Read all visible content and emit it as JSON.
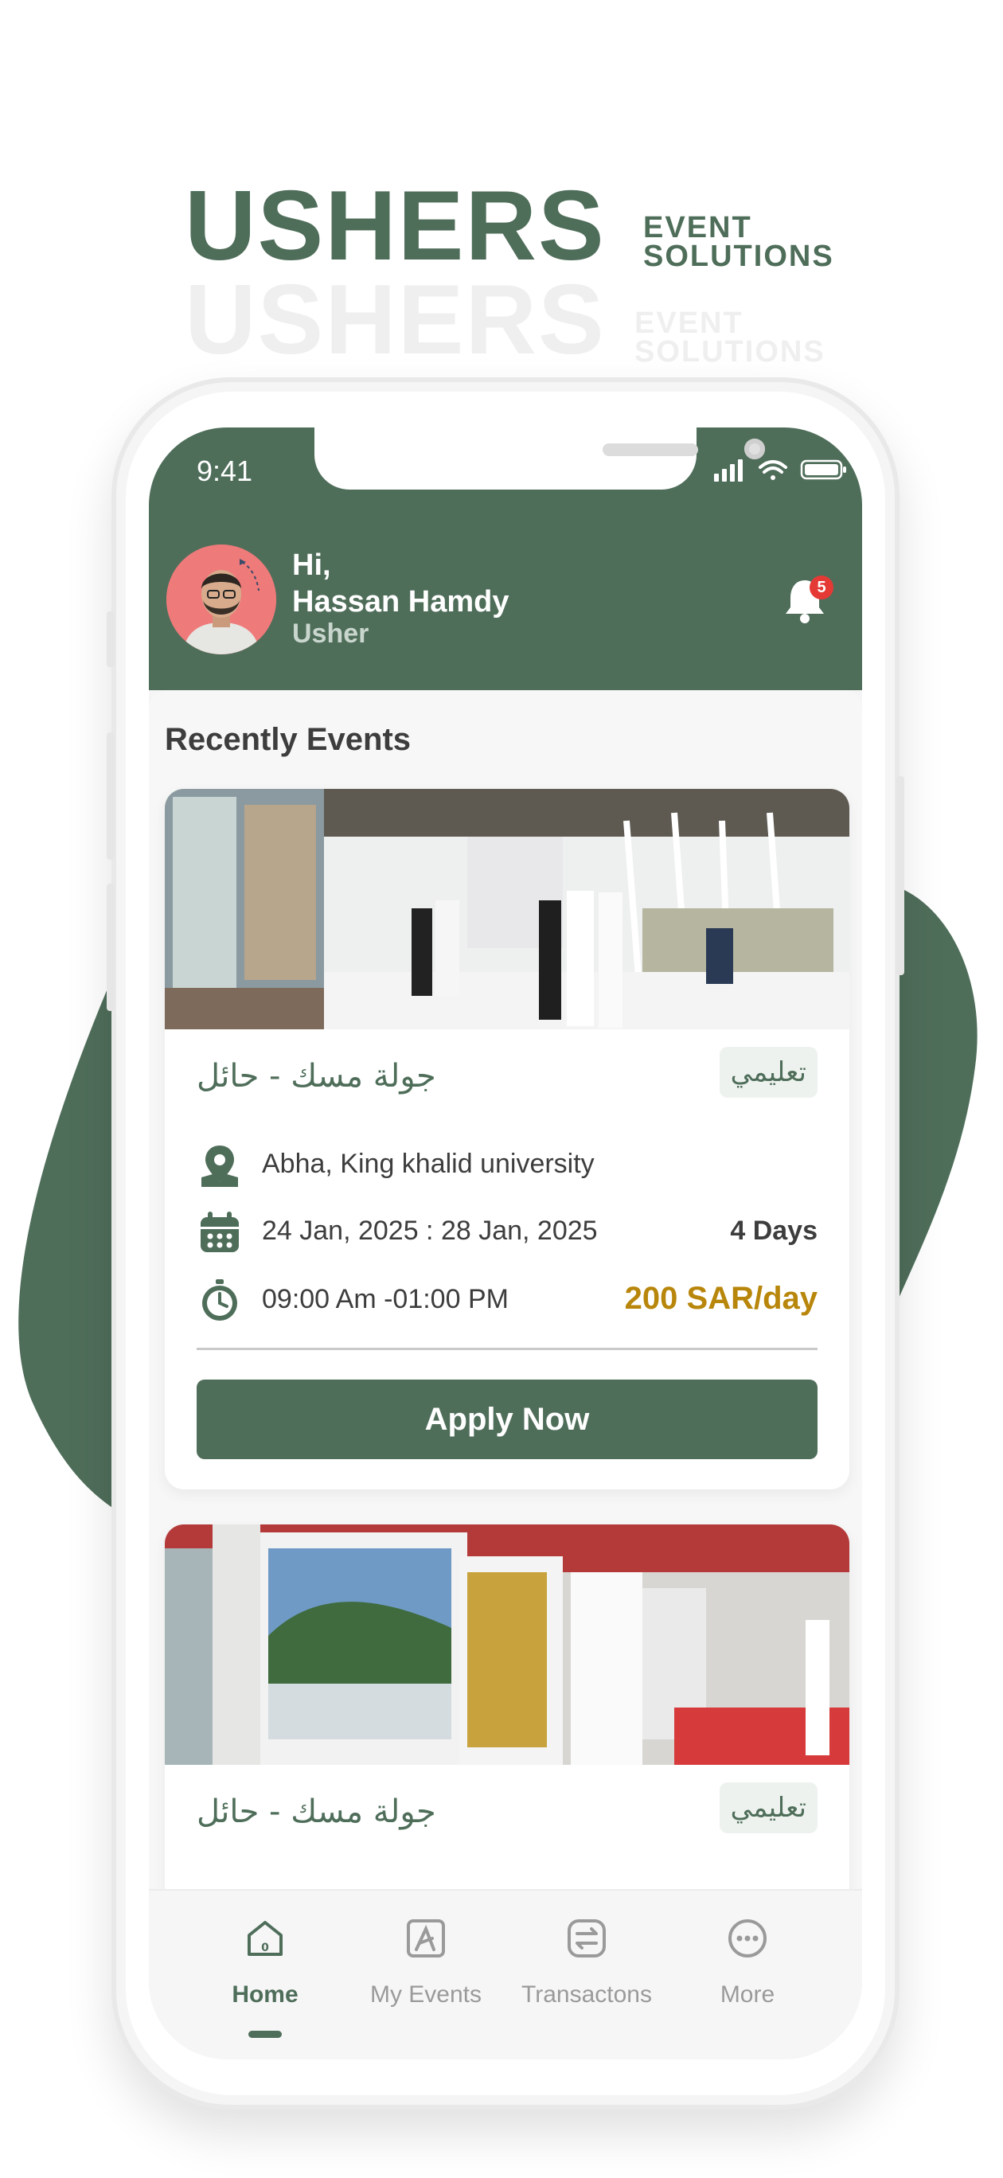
{
  "brand": {
    "name": "USHERS",
    "tagline_line1": "EVENT",
    "tagline_line2": "SOLUTIONS"
  },
  "status_bar": {
    "time": "9:41"
  },
  "header": {
    "greeting": "Hi,",
    "user_name": "Hassan Hamdy",
    "role": "Usher",
    "notification_count": "5"
  },
  "section": {
    "title": "Recently Events"
  },
  "events": [
    {
      "title": "جولة مسك - حائل",
      "tag": "تعليمي",
      "location": "Abha, King khalid university",
      "dates": "24 Jan, 2025 : 28 Jan, 2025",
      "duration": "4 Days",
      "time": "09:00 Am -01:00 PM",
      "price": "200 SAR/day",
      "cta": "Apply Now"
    },
    {
      "title": "جولة مسك - حائل",
      "tag": "تعليمي"
    }
  ],
  "nav": {
    "items": [
      {
        "label": "Home",
        "icon": "home-icon",
        "active": true
      },
      {
        "label": "My Events",
        "icon": "events-icon",
        "active": false
      },
      {
        "label": "Transactons",
        "icon": "transactions-icon",
        "active": false
      },
      {
        "label": "More",
        "icon": "more-icon",
        "active": false
      }
    ]
  },
  "colors": {
    "brand_green": "#4f6e5a",
    "price_gold": "#b8860b",
    "badge_red": "#e53935"
  }
}
